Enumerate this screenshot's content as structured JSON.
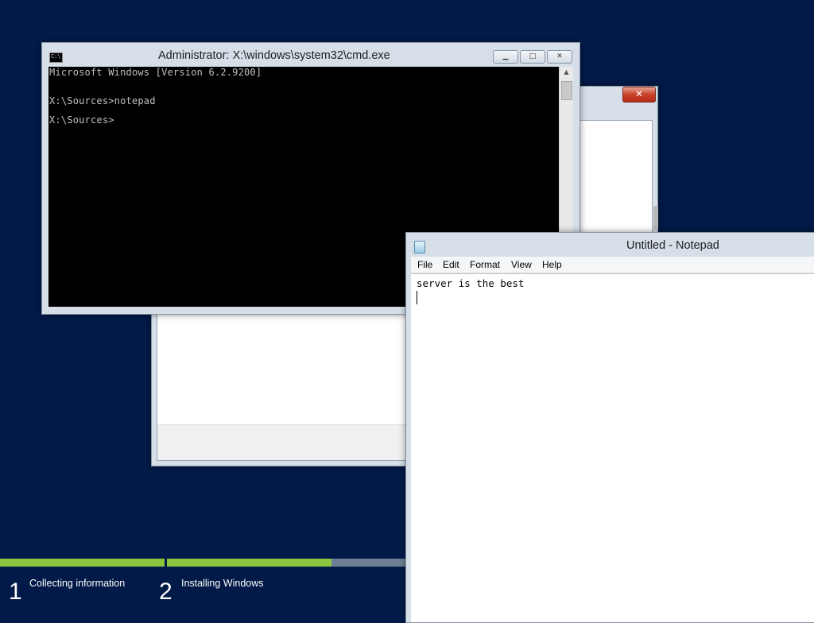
{
  "setup": {
    "steps": [
      {
        "number": "1",
        "label": "Collecting information",
        "progress": 1.0
      },
      {
        "number": "2",
        "label": "Installing Windows",
        "progress": 0.69
      }
    ],
    "dialog": {
      "close_icon": "close-icon"
    }
  },
  "cmd": {
    "title": "Administrator: X:\\windows\\system32\\cmd.exe",
    "icon_text": "C:\\",
    "lines": [
      "Microsoft Windows [Version 6.2.9200]",
      "",
      "X:\\Sources>notepad",
      "",
      "X:\\Sources>"
    ],
    "buttons": {
      "minimize": "▁",
      "maximize": "□",
      "close": "✕"
    }
  },
  "notepad": {
    "title": "Untitled - Notepad",
    "menu": [
      "File",
      "Edit",
      "Format",
      "View",
      "Help"
    ],
    "text": "server is the best"
  },
  "colors": {
    "desktop": "#021a48",
    "progress_fill": "#8cc63f",
    "progress_track": "#6e7f93",
    "close_red": "#c7412b"
  }
}
